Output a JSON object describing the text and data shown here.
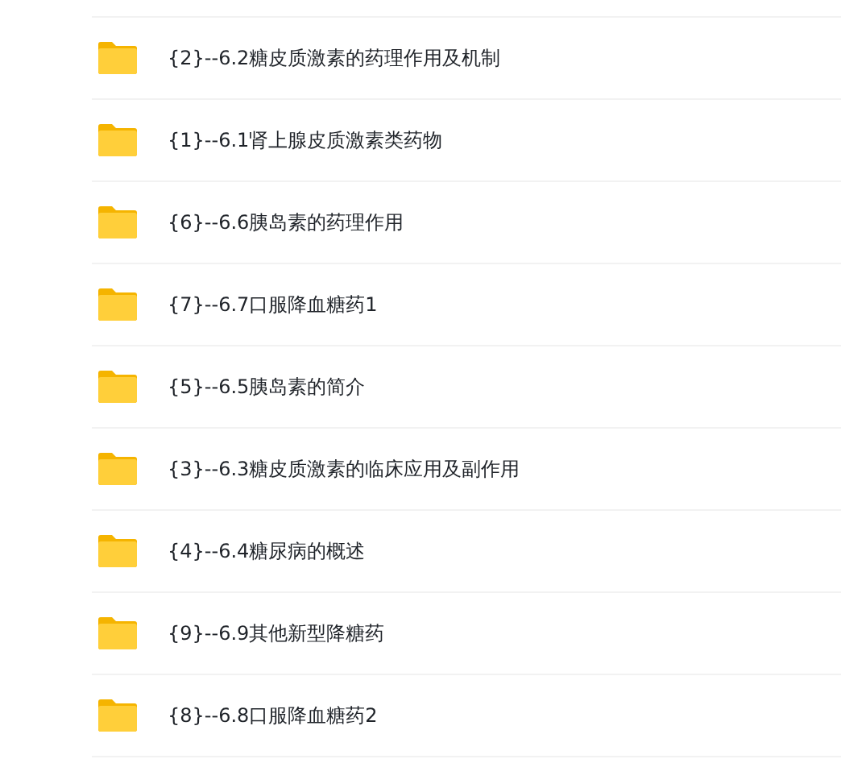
{
  "folders": [
    {
      "name": "{2}--6.2糖皮质激素的药理作用及机制"
    },
    {
      "name": "{1}--6.1肾上腺皮质激素类药物"
    },
    {
      "name": "{6}--6.6胰岛素的药理作用"
    },
    {
      "name": "{7}--6.7口服降血糖药1"
    },
    {
      "name": "{5}--6.5胰岛素的简介"
    },
    {
      "name": "{3}--6.3糖皮质激素的临床应用及副作用"
    },
    {
      "name": "{4}--6.4糖尿病的概述"
    },
    {
      "name": "{9}--6.9其他新型降糖药"
    },
    {
      "name": "{8}--6.8口服降血糖药2"
    }
  ]
}
